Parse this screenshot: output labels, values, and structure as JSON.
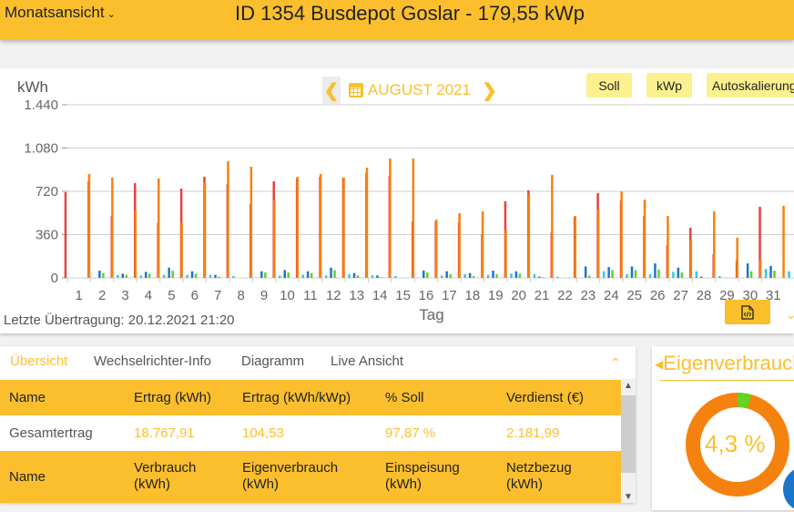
{
  "header": {
    "view_select": "Monatsansicht",
    "title": "ID 1354 Busdepot Goslar - 179,55 kWp"
  },
  "chart_panel": {
    "unit": "kWh",
    "month": "AUGUST 2021",
    "buttons": {
      "soll": "Soll",
      "kwp": "kWp",
      "autoscale": "Autoskalierung"
    },
    "last_transmission": "Letzte Übertragung: 20.12.2021 21:20"
  },
  "chart_data": {
    "type": "bar",
    "title": "AUGUST 2021",
    "xlabel": "Tag",
    "ylabel": "kWh",
    "ylim": [
      0,
      1440
    ],
    "yticks": [
      0,
      360,
      720,
      1080,
      1440
    ],
    "ytick_labels": [
      "0",
      "360",
      "720",
      "1.080",
      "1.440"
    ],
    "grid": true,
    "categories": [
      "1",
      "2",
      "3",
      "4",
      "5",
      "6",
      "7",
      "8",
      "9",
      "10",
      "11",
      "12",
      "13",
      "14",
      "15",
      "16",
      "17",
      "18",
      "19",
      "20",
      "21",
      "22",
      "23",
      "24",
      "25",
      "26",
      "27",
      "28",
      "29",
      "30",
      "31"
    ],
    "series": [
      {
        "name": "Ertrag",
        "color": "#e8413c",
        "values": [
          712,
          803,
          515,
          788,
          455,
          743,
          841,
          780,
          614,
          803,
          826,
          841,
          834,
          872,
          849,
          470,
          470,
          462,
          364,
          637,
          728,
          379,
          508,
          705,
          644,
          515,
          273,
          417,
          197,
          144,
          591
        ]
      },
      {
        "name": "Verbrauch",
        "color": "#1b76c9",
        "values": [
          0,
          60,
          35,
          50,
          85,
          55,
          25,
          0,
          55,
          65,
          55,
          85,
          40,
          20,
          0,
          60,
          55,
          40,
          60,
          55,
          10,
          0,
          95,
          90,
          95,
          120,
          85,
          10,
          0,
          120,
          100
        ]
      },
      {
        "name": "Eigenverbrauch",
        "color": "#66d11f",
        "values": [
          0,
          40,
          25,
          35,
          60,
          35,
          10,
          0,
          45,
          45,
          40,
          65,
          20,
          5,
          0,
          45,
          30,
          15,
          30,
          35,
          5,
          0,
          20,
          65,
          65,
          70,
          45,
          0,
          0,
          55,
          60
        ]
      },
      {
        "name": "Soll",
        "color": "#f5820e",
        "values": [
          864,
          834,
          561,
          826,
          462,
          788,
          970,
          925,
          644,
          841,
          864,
          834,
          917,
          993,
          993,
          485,
          538,
          553,
          402,
          690,
          857,
          515,
          569,
          720,
          652,
          515,
          311,
          553,
          334,
          152,
          599
        ]
      },
      {
        "name": "Netzbezug",
        "color": "#33c8de",
        "values": [
          0,
          25,
          20,
          25,
          25,
          25,
          15,
          0,
          20,
          25,
          20,
          30,
          20,
          15,
          0,
          20,
          30,
          25,
          35,
          30,
          10,
          0,
          55,
          30,
          30,
          50,
          55,
          15,
          0,
          75,
          55
        ]
      }
    ]
  },
  "table": {
    "tabs": [
      "Übersicht",
      "Wechselrichter-Info",
      "Diagramm",
      "Live Ansicht"
    ],
    "header1": [
      "Name",
      "Ertrag (kWh)",
      "Ertrag (kWh/kWp)",
      "% Soll",
      "Verdienst (€)"
    ],
    "row1": [
      "Gesamtertrag",
      "18.767,91",
      "104,53",
      "97,87 %",
      "2.181,99"
    ],
    "header2": [
      "Name",
      "Verbrauch (kWh)",
      "Eigenverbrauch (kWh)",
      "Einspeisung (kWh)",
      "Netzbezug (kWh)"
    ]
  },
  "donut": {
    "title": "Eigenverbrauch",
    "value_label": "4,3 %",
    "percent": 4.3,
    "colors": {
      "main": "#f5820e",
      "part": "#66d11f"
    }
  }
}
